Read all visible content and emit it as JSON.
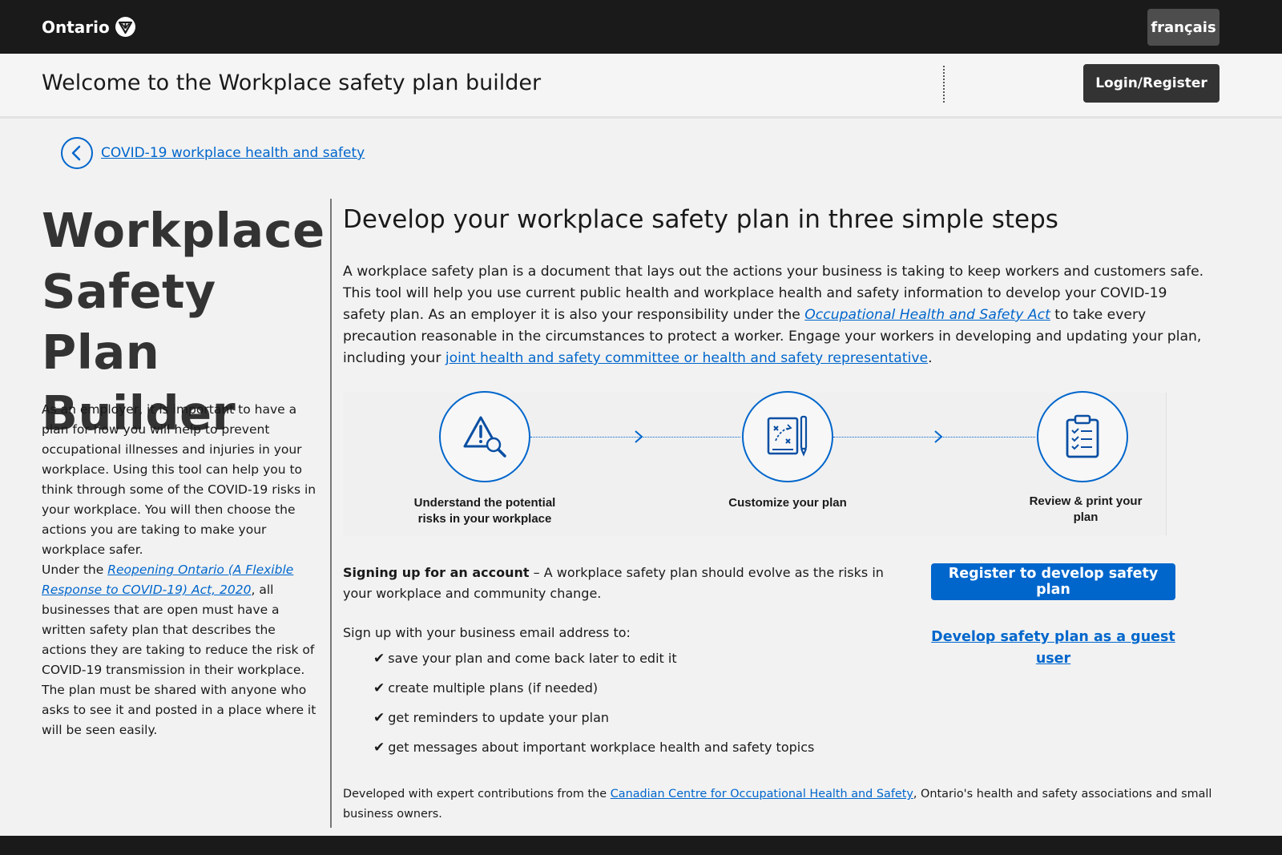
{
  "header": {
    "logo_text": "Ontario",
    "language_button": "français",
    "title": "Welcome to the Workplace safety plan builder",
    "login_button": "Login/Register"
  },
  "breadcrumb": {
    "back_link": "COVID-19 workplace health and safety"
  },
  "left": {
    "title_line1": "Workplace",
    "title_line2": "Safety Plan",
    "title_line3": "Builder",
    "paragraph1": "As an employer, it is important to have a plan for how you will help to prevent occupational illnesses and injuries in your workplace. Using this tool can help you to think through some of the COVID-19 risks in your workplace. You will then choose the actions you are taking to make your workplace safer.",
    "paragraph2_prefix": "Under the ",
    "paragraph2_link": "Reopening Ontario (A Flexible Response to COVID-19) Act, 2020",
    "paragraph2_suffix": ", all businesses that are open must have a written safety plan that describes the actions they are taking to reduce the risk of COVID-19 transmission in their workplace. The plan must be shared with anyone who asks to see it and posted in a place where it will be seen easily."
  },
  "main": {
    "heading": "Develop your workplace safety plan in three simple steps",
    "intro_part1": "A workplace safety plan is a document that lays out the actions your business is taking to keep workers and customers safe. This tool will help you use current public health and workplace health and safety information to develop your COVID-19 safety plan. As an employer it is also your responsibility under the ",
    "intro_link1": "Occupational Health and Safety Act",
    "intro_part2": " to take every precaution reasonable in the circumstances to protect a worker. Engage your workers in developing and updating your plan, including your ",
    "intro_link2": "joint health and safety committee or health and safety representative",
    "intro_part3": ".",
    "steps": [
      {
        "label": "Understand the potential risks in your workplace",
        "icon": "warning-search-icon"
      },
      {
        "label": "Customize your plan",
        "icon": "strategy-board-icon"
      },
      {
        "label": "Review & print your plan",
        "icon": "clipboard-checklist-icon"
      }
    ],
    "signup_bold": "Signing up for an account",
    "signup_text": " – A workplace safety plan should evolve as the risks in your workplace and community change.",
    "signup_intro": "Sign up with your business email address to:",
    "benefits": [
      "save your plan and come back later to edit it",
      "create multiple plans (if needed)",
      "get reminders to update your plan",
      "get messages about important workplace health and safety topics"
    ],
    "register_button": "Register to develop safety plan",
    "guest_link": "Develop safety plan as a guest user",
    "footer_prefix": "Developed with expert contributions from the ",
    "footer_link": "Canadian Centre for Occupational Health and Safety",
    "footer_suffix": ", Ontario's health and safety associations and small business owners."
  },
  "colors": {
    "accent": "#0066cc",
    "topbar": "#1a1a1a"
  }
}
